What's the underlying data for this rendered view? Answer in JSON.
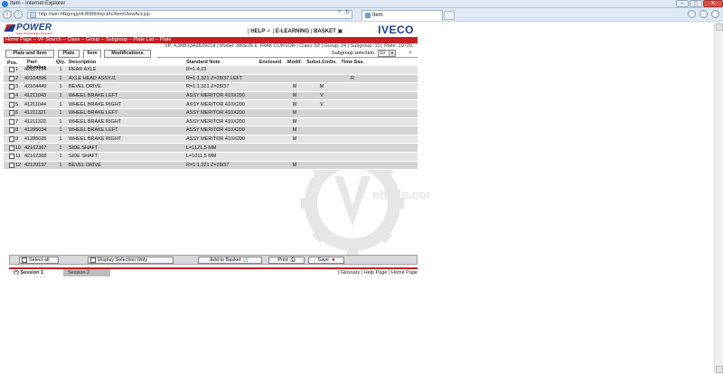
{
  "window": {
    "title": "Item - Internet Explorer",
    "url": "http://win-f4kgmgyr4:8080/myctrlc/ItemViewAct.jsp",
    "tab_label": "Item",
    "min_label": "–",
    "max_label": "□",
    "close_label": "✕"
  },
  "header": {
    "logo_text": "POWER",
    "logo_tagline": "Parts On Web Easy Research",
    "links": [
      "HELP",
      "E-LEARNING",
      "BASKET"
    ],
    "brand": "IVECO"
  },
  "breadcrumb": "Home Page -- VF Search -- Class -- Group -- Subgroup -- Plate List -- Plate",
  "info_line": "VP: K3RB13A3B20014 | Model: 380E35 E.TRAK CURSOR | Class: 52 | Group: 24 | Subgroup: 10 | Plate: 10720",
  "tabs": [
    "Plate and Item",
    "Plate",
    "Item",
    "Modifications"
  ],
  "subgroup": {
    "label": "Subgroup selection",
    "value": "10"
  },
  "table": {
    "columns": [
      "Pos.",
      "Part Number",
      "Qty.",
      "Description",
      "Standard Note",
      "Enclosed",
      "Modif.",
      "Subst.",
      "Codis.",
      "Time Sav."
    ],
    "rows": [
      {
        "pos": "1",
        "part": "42127234",
        "qty": "1",
        "desc": "REAR AXLE",
        "note": "R=1:4,23",
        "encl": "",
        "modif": "",
        "subst": "",
        "time": ""
      },
      {
        "pos": "2",
        "part": "42104396",
        "qty": "1",
        "desc": "AXLE HEAD ASSY./1",
        "note": "R=1:1,321 Z=28/37 LEFT",
        "encl": "",
        "modif": "",
        "subst": "",
        "time": "R"
      },
      {
        "pos": "3",
        "part": "42104449",
        "qty": "1",
        "desc": "BEVEL DRIVE",
        "note": "R=1:1,321 Z=28/37",
        "encl": "",
        "modif": "M",
        "subst": "M",
        "time": ""
      },
      {
        "pos": "4",
        "part": "41211043",
        "qty": "1",
        "desc": "WHEEL BRAKE LEFT",
        "note": "ASSY MERITOR 410X200",
        "encl": "",
        "modif": "M",
        "subst": "V",
        "time": ""
      },
      {
        "pos": "5",
        "part": "41211044",
        "qty": "1",
        "desc": "WHEEL BRAKE RIGHT",
        "note": "ASSY MERITOR 410X200",
        "encl": "",
        "modif": "M",
        "subst": "V",
        "time": ""
      },
      {
        "pos": "6",
        "part": "41211321",
        "qty": "1",
        "desc": "WHEEL BRAKE LEFT",
        "note": "ASSY MERITOR 410X200",
        "encl": "",
        "modif": "M",
        "subst": "",
        "time": ""
      },
      {
        "pos": "7",
        "part": "41211322",
        "qty": "1",
        "desc": "WHEEL BRAKE RIGHT",
        "note": "ASSY MERITOR 410X200",
        "encl": "",
        "modif": "M",
        "subst": "",
        "time": ""
      },
      {
        "pos": "8",
        "part": "41285034",
        "qty": "1",
        "desc": "WHEEL BRAKE LEFT",
        "note": "ASSY MERITOR 410X200",
        "encl": "",
        "modif": "M",
        "subst": "",
        "time": ""
      },
      {
        "pos": "9",
        "part": "41285035",
        "qty": "1",
        "desc": "WHEEL BRAKE RIGHT",
        "note": "ASSY MERITOR 410X200",
        "encl": "",
        "modif": "M",
        "subst": "",
        "time": ""
      },
      {
        "pos": "10",
        "part": "42102367",
        "qty": "1",
        "desc": "SIDE SHAFT",
        "note": "L=1121,5 MM",
        "encl": "",
        "modif": "",
        "subst": "",
        "time": ""
      },
      {
        "pos": "11",
        "part": "42102368",
        "qty": "1",
        "desc": "SIDE SHAFT",
        "note": "L=1011,5 MM",
        "encl": "",
        "modif": "",
        "subst": "",
        "time": ""
      },
      {
        "pos": "12",
        "part": "42129197",
        "qty": "1",
        "desc": "BEVEL DRIVE",
        "note": "R=1:1,321 Z=28/37",
        "encl": "",
        "modif": "M",
        "subst": "",
        "time": ""
      }
    ]
  },
  "actions": {
    "select_all": "Select all",
    "display_selection": "Display Selection Only",
    "add_to_basket": "Add to Basket",
    "print": "Print",
    "save": "Save"
  },
  "sessions": [
    "(*) Session 1",
    "Session 2"
  ],
  "footer_links": "| Glossary | Help Page | Home Page"
}
